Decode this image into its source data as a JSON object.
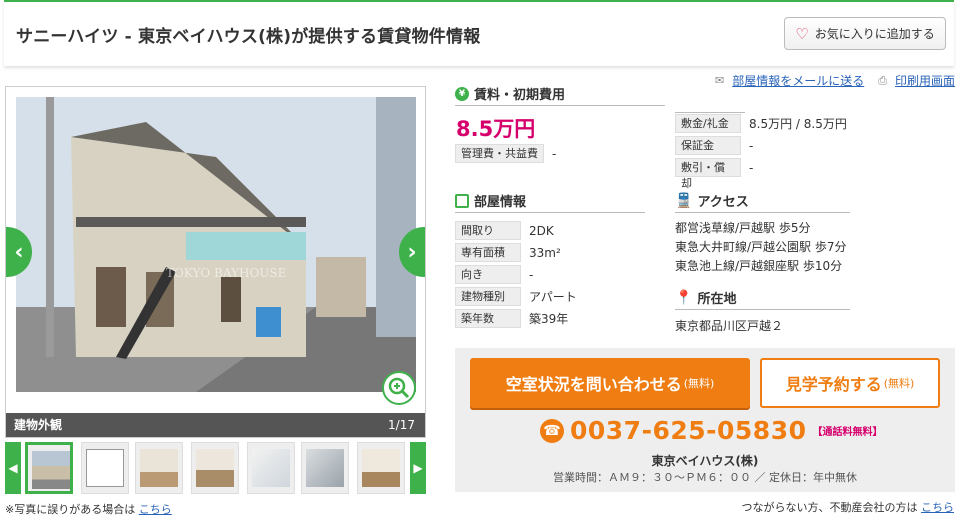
{
  "header": {
    "title": "サニーハイツ - 東京ベイハウス(株)が提供する賃貸物件情報",
    "favorite_label": "お気に入りに追加する"
  },
  "photo": {
    "caption": "建物外観",
    "counter": "1/17",
    "note": "※写真に誤りがある場合は",
    "note_link": "こちら"
  },
  "top_links": {
    "mail": "部屋情報をメールに送る",
    "print": "印刷用画面"
  },
  "rent": {
    "section_title": "賃料・初期費用",
    "price": "8.5万円",
    "management_label": "管理費・共益費",
    "management_value": "-",
    "deposit_label": "敷金/礼金",
    "deposit_value": "8.5万円 / 8.5万円",
    "guarantee_label": "保証金",
    "guarantee_value": "-",
    "shikibiki_label": "敷引・償却",
    "shikibiki_value": "-"
  },
  "room": {
    "section_title": "部屋情報",
    "rows": [
      {
        "label": "間取り",
        "value": "2DK"
      },
      {
        "label": "専有面積",
        "value": "33m²"
      },
      {
        "label": "向き",
        "value": "-"
      },
      {
        "label": "建物種別",
        "value": "アパート"
      },
      {
        "label": "築年数",
        "value": "築39年"
      }
    ]
  },
  "access": {
    "section_title": "アクセス",
    "lines": [
      "都営浅草線/戸越駅 歩5分",
      "東急大井町線/戸越公園駅 歩7分",
      "東急池上線/戸越銀座駅 歩10分"
    ]
  },
  "location": {
    "section_title": "所在地",
    "address": "東京都品川区戸越２"
  },
  "contact": {
    "inquiry_label": "空室状況を問い合わせる",
    "inquiry_free": "(無料)",
    "visit_label": "見学予約する",
    "visit_free": "(無料)",
    "phone": "0037-625-05830",
    "phone_free": "【通話料無料】",
    "company": "東京ベイハウス(株)",
    "hours": "営業時間：ＡＭ９：３０～ＰＭ６：００ ／ 定休日：年中無休"
  },
  "bottom": {
    "note": "つながらない方、不動産会社の方は",
    "link": "こちら"
  },
  "colors": {
    "accent_green": "#3fb14b",
    "price_pink": "#d6006d",
    "orange": "#f07d12",
    "link_blue": "#2a64b8"
  }
}
